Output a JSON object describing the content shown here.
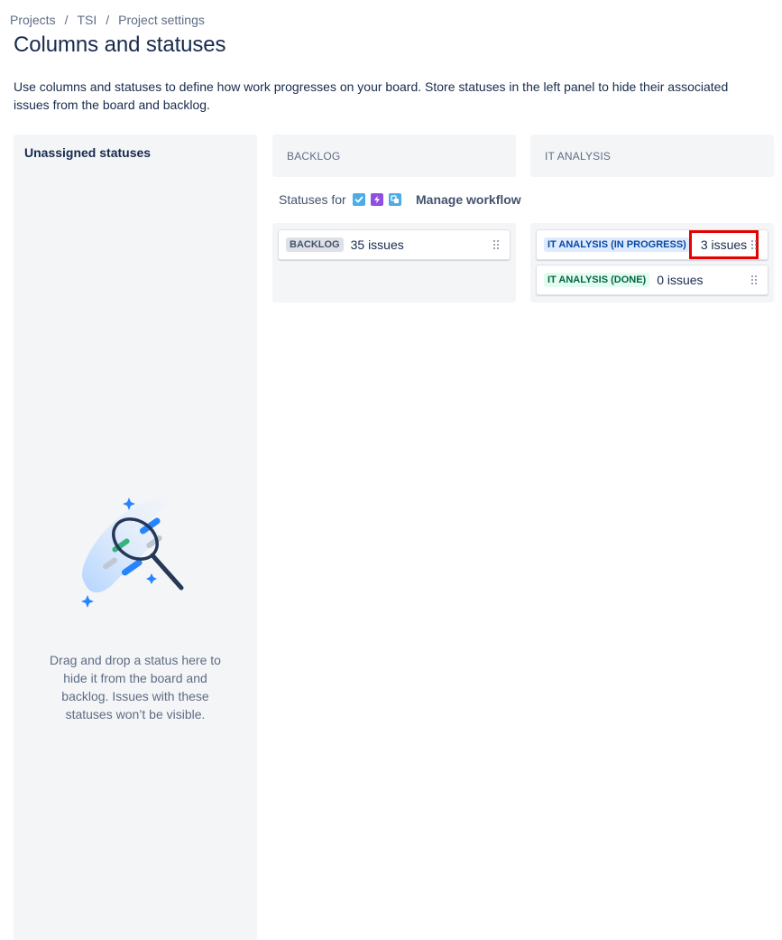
{
  "breadcrumb": {
    "items": [
      "Projects",
      "TSI",
      "Project settings"
    ],
    "separator": "/"
  },
  "page": {
    "title": "Columns and statuses",
    "description": "Use columns and statuses to define how work progresses on your board. Store statuses in the left panel to hide their associated issues from the board and backlog."
  },
  "unassigned": {
    "title": "Unassigned statuses",
    "help": "Drag and drop a status here to hide it from the board and backlog. Issues with these statuses won’t be visible.",
    "illustration_icon": "badminton-racket-illustration"
  },
  "statuses_for": {
    "label": "Statuses for",
    "icons": [
      "task-icon",
      "epic-icon",
      "subtask-icon"
    ],
    "manage_workflow": "Manage workflow"
  },
  "columns": [
    {
      "name": "BACKLOG",
      "statuses": [
        {
          "name": "BACKLOG",
          "count": "35 issues",
          "color": "grey"
        }
      ]
    },
    {
      "name": "IT ANALYSIS",
      "statuses": [
        {
          "name": "IT ANALYSIS (IN PROGRESS)",
          "count": "3 issues",
          "color": "blue",
          "highlighted": true
        },
        {
          "name": "IT ANALYSIS (DONE)",
          "count": "0 issues",
          "color": "green"
        }
      ]
    }
  ],
  "colors": {
    "highlight": "#e60000",
    "panel_bg": "#f4f5f7",
    "text": "#172b4d"
  }
}
